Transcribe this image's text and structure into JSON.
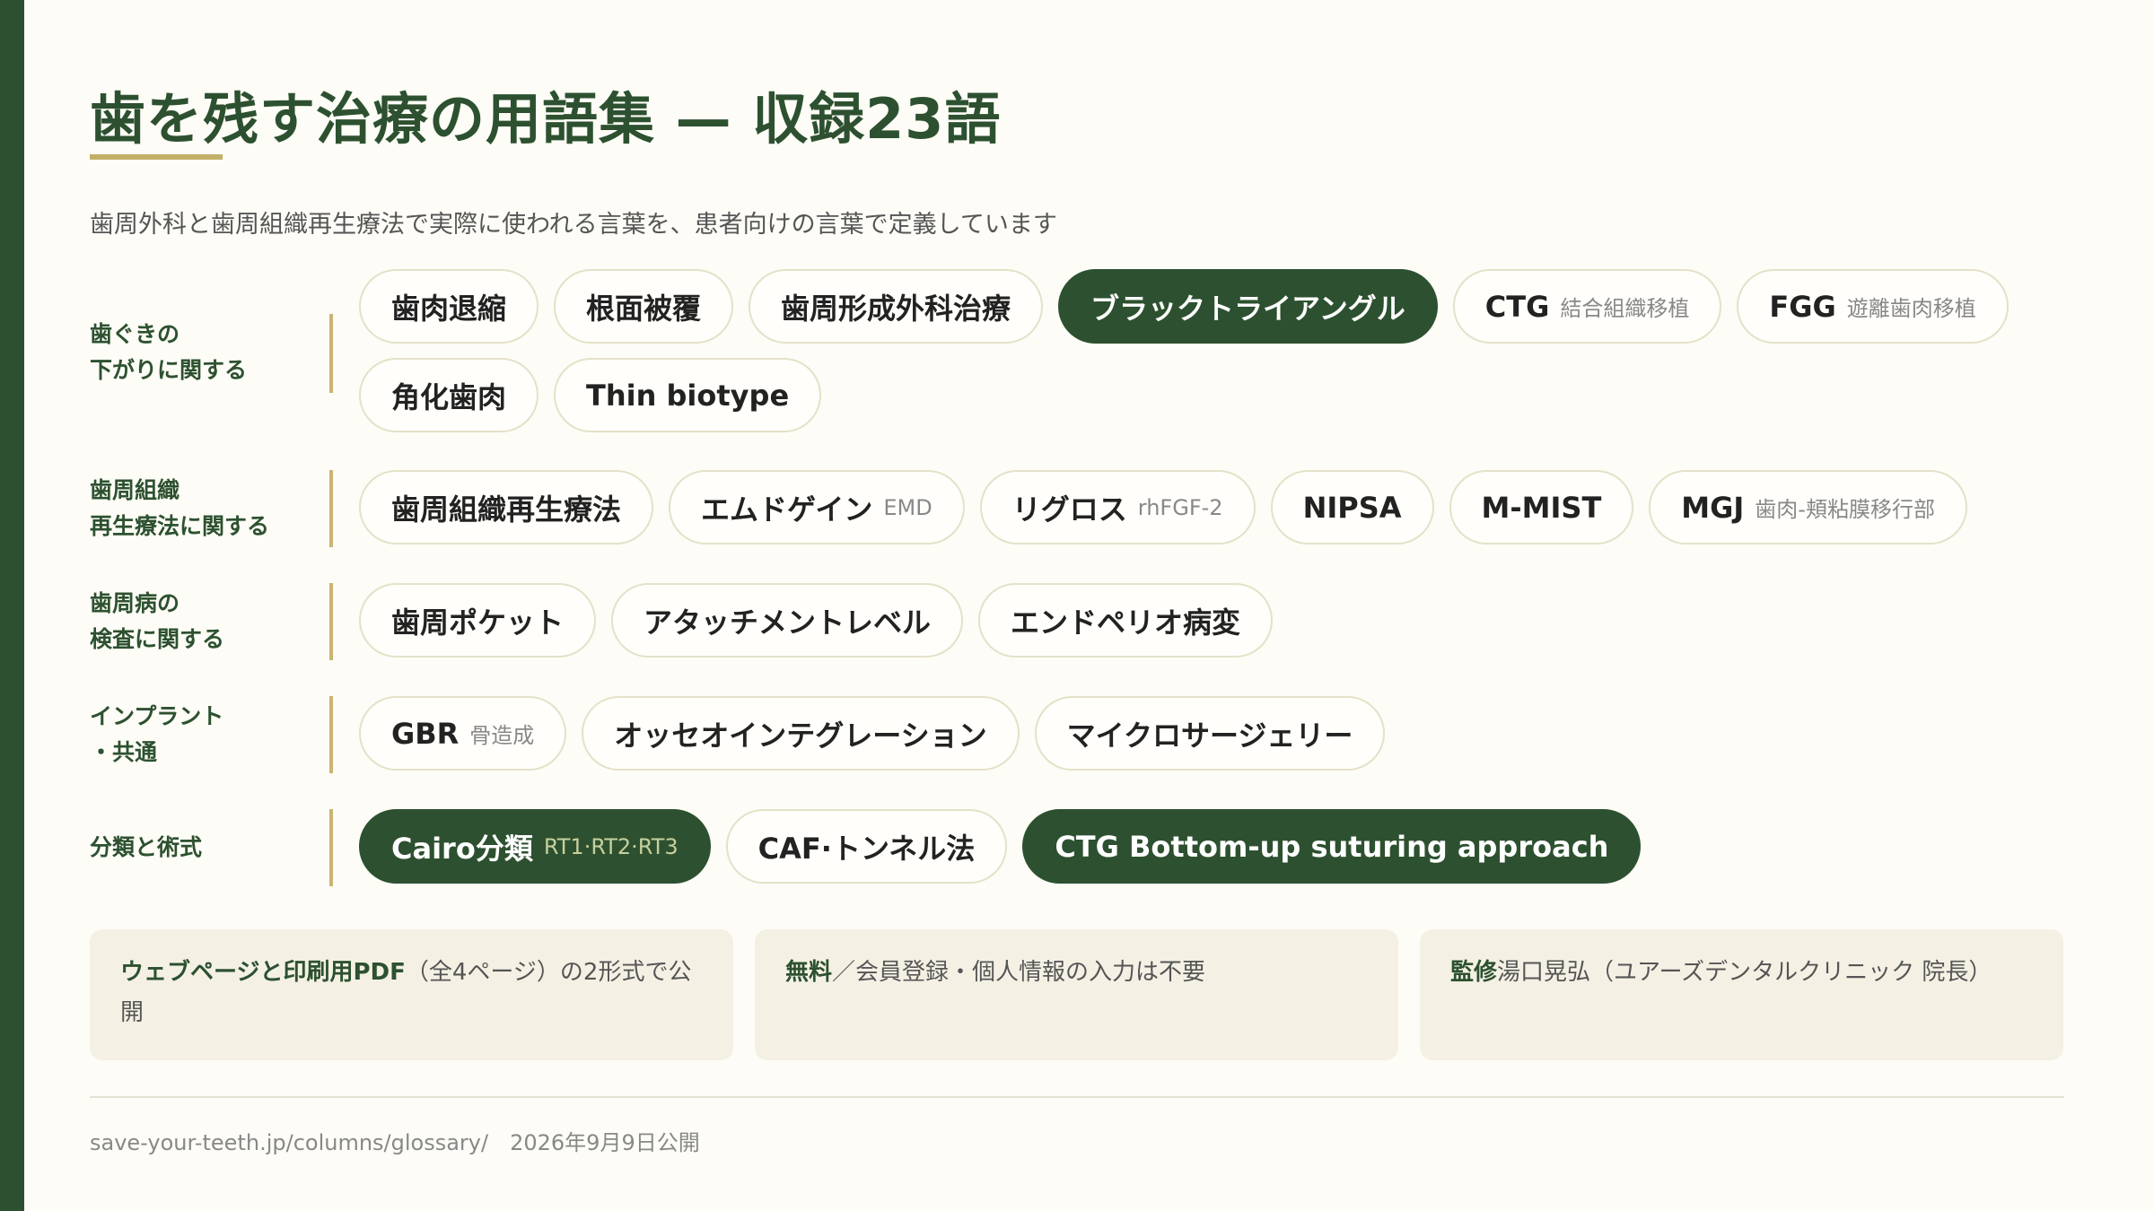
{
  "header": {
    "title": "歯を残す治療の用語集 — 収録23語",
    "subtitle": "歯周外科と歯周組織再生療法で実際に使われる言葉を、患者向けの言葉で定義しています"
  },
  "categories": [
    {
      "label": "歯ぐきの\n下がりに関する",
      "tags": [
        {
          "main": "歯肉退縮",
          "sub": "",
          "dark": false
        },
        {
          "main": "根面被覆",
          "sub": "",
          "dark": false
        },
        {
          "main": "歯周形成外科治療",
          "sub": "",
          "dark": false
        },
        {
          "main": "ブラックトライアングル",
          "sub": "",
          "dark": true
        },
        {
          "main": "CTG",
          "sub": "結合組織移植",
          "dark": false
        },
        {
          "main": "FGG",
          "sub": "遊離歯肉移植",
          "dark": false
        },
        {
          "main": "角化歯肉",
          "sub": "",
          "dark": false
        },
        {
          "main": "Thin biotype",
          "sub": "",
          "dark": false
        }
      ]
    },
    {
      "label": "歯周組織\n再生療法に関する",
      "tags": [
        {
          "main": "歯周組織再生療法",
          "sub": "",
          "dark": false
        },
        {
          "main": "エムドゲイン",
          "sub": "EMD",
          "dark": false
        },
        {
          "main": "リグロス",
          "sub": "rhFGF-2",
          "dark": false
        },
        {
          "main": "NIPSA",
          "sub": "",
          "dark": false
        },
        {
          "main": "M-MIST",
          "sub": "",
          "dark": false
        },
        {
          "main": "MGJ",
          "sub": "歯肉-頬粘膜移行部",
          "dark": false
        }
      ]
    },
    {
      "label": "歯周病の\n検査に関する",
      "tags": [
        {
          "main": "歯周ポケット",
          "sub": "",
          "dark": false
        },
        {
          "main": "アタッチメントレベル",
          "sub": "",
          "dark": false
        },
        {
          "main": "エンドペリオ病変",
          "sub": "",
          "dark": false
        }
      ]
    },
    {
      "label": "インプラント\n・共通",
      "tags": [
        {
          "main": "GBR",
          "sub": "骨造成",
          "dark": false
        },
        {
          "main": "オッセオインテグレーション",
          "sub": "",
          "dark": false
        },
        {
          "main": "マイクロサージェリー",
          "sub": "",
          "dark": false
        }
      ]
    },
    {
      "label": "分類と術式",
      "tags": [
        {
          "main": "Cairo分類",
          "sub": "RT1·RT2·RT3",
          "dark": true
        },
        {
          "main": "CAF·トンネル法",
          "sub": "",
          "dark": false
        },
        {
          "main": "CTG Bottom-up suturing approach",
          "sub": "",
          "dark": true
        }
      ]
    }
  ],
  "info": [
    {
      "strong": "ウェブページと印刷用PDF",
      "text": "（全4ページ）の2形式で公開"
    },
    {
      "strong": "無料",
      "text": "／会員登録・個人情報の入力は不要"
    },
    {
      "strong": "監修",
      "text": "湯口晃弘（ユアーズデンタルクリニック 院長）"
    }
  ],
  "footer": {
    "url": "save-your-teeth.jp/columns/glossary/",
    "date": "2026年9月9日公開"
  },
  "colors": {
    "accent": "#2d5130",
    "gold": "#c2b067",
    "background": "#fdfcf6"
  }
}
